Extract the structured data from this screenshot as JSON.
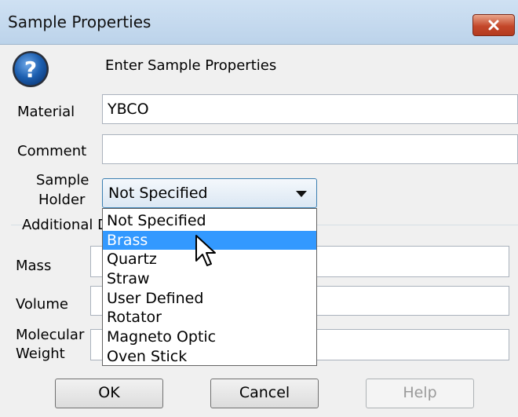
{
  "window": {
    "title": "Sample Properties"
  },
  "header": {
    "prompt": "Enter Sample Properties",
    "icon": "question-icon"
  },
  "fields": {
    "material_label": "Material",
    "material_value": "YBCO",
    "comment_label": "Comment",
    "comment_value": "",
    "holder_label_line1": "Sample",
    "holder_label_line2": "Holder",
    "holder_selected": "Not Specified",
    "additional_label": "Additional D",
    "mass_label": "Mass",
    "volume_label": "Volume",
    "mw_label_line1": "Molecular",
    "mw_label_line2": "Weight"
  },
  "dropdown": {
    "options": [
      "Not Specified",
      "Brass",
      "Quartz",
      "Straw",
      "User Defined",
      "Rotator",
      "Magneto Optic",
      "Oven Stick"
    ],
    "highlighted": "Brass"
  },
  "buttons": {
    "ok": "OK",
    "cancel": "Cancel",
    "help": "Help"
  },
  "colors": {
    "highlight": "#3399ff",
    "close_button": "#c4482a",
    "icon_blue": "#1d5fb0"
  }
}
